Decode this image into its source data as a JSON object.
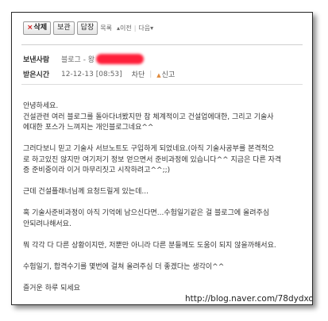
{
  "toolbar": {
    "delete_label": "삭제",
    "save_label": "보관",
    "reply_label": "답장",
    "list_label": "목록",
    "prev_label": "이전",
    "next_label": "다음"
  },
  "header": {
    "sender_label": "보낸사람",
    "sender_value": "블로그 - 왕",
    "received_label": "받은시간",
    "received_value": "12-12-13 [08:53]",
    "block_label": "차단",
    "report_label": "신고"
  },
  "message": {
    "lines": [
      "안녕하세요.",
      "건설관련 여러 블로그를 돌아다녀봤지만 참 체계적이고 건설업에대한, 그리고 기술사",
      "에대한 포스가 느껴지는 개인블로그네요^^",
      "",
      "그러다보니 믿고 기술사 서브노트도 구입하게 되었네요.(아직 기술사공부를 본격적으",
      "로 하고있진 않지만 여기저기 정보 얻으면서 준비과정에 있습니다^^ 지금은 다른 자격",
      "증 준비중이라 이거 마무리짓고 시작하려고^^;;)",
      "",
      "근데 건설플래너님께 요청드릴게 있는데...",
      "",
      "혹 기술사준비과정이 아직 기억에 남으신다면...수험일기같은 걸 블로그에 올려주심",
      "안되려나해서요.",
      "",
      "뭐 각각 다 다른 상황이지만, 저뿐만 아니라 다른 분들께도 도움이 되지 않을까해서요.",
      "",
      "수험일기, 합격수기를 몇번에 걸쳐 올려주심 더 좋겠다는 생각이^^",
      "",
      "즐거운 하루 되세요"
    ]
  },
  "watermark": "http://blog.naver.com/78dydxo",
  "colors": {
    "delete_x": "#d21414",
    "redaction": "#ff1f3a",
    "report_icon": "#e08a3c"
  }
}
